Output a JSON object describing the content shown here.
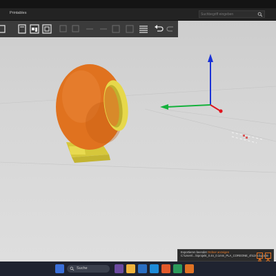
{
  "menubar": {
    "label": "Printables"
  },
  "search": {
    "placeholder": "Suchbegriff eingeben"
  },
  "toast": {
    "line1_a": "Exportieren beendet",
    "line1_link": "Ordner anzeigen",
    "line2": "C:\\Users\\...\\Sprojekt_0.4n_0.1mm_PLA_COREONE_4h12m.bgcode"
  },
  "taskbar": {
    "search_label": "Suche"
  },
  "colors": {
    "accent": "#ee7d2a",
    "model_orange": "#e0721f",
    "model_yellow": "#e6d84a",
    "axis_x": "#e0141e",
    "axis_y": "#13b13b",
    "axis_z": "#1a32d6"
  },
  "icons": [
    "arrange-icon",
    "copy-icon",
    "paste-icon",
    "split-icon",
    "layers-icon",
    "undo-icon",
    "redo-icon"
  ]
}
